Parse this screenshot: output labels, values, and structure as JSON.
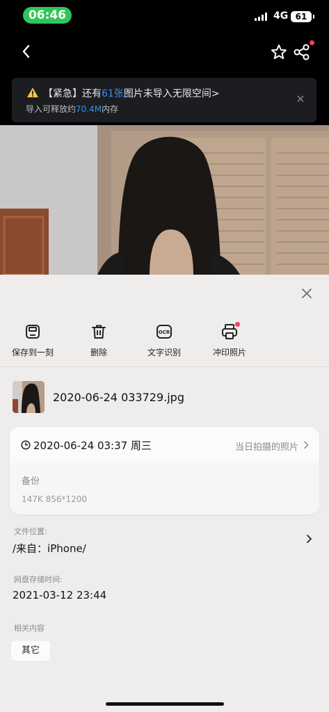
{
  "status_bar": {
    "time": "06:46",
    "network": "4G",
    "battery": "61"
  },
  "banner": {
    "title_prefix": "【紧急】还有",
    "title_count": "61张",
    "title_suffix": "图片未导入无限空间>",
    "sub_prefix": "导入可释放约",
    "sub_size": "70.4M",
    "sub_suffix": "内存"
  },
  "actions": [
    {
      "label": "保存到一刻",
      "icon": "save-icon"
    },
    {
      "label": "删除",
      "icon": "trash-icon"
    },
    {
      "label": "文字识别",
      "icon": "ocr-icon"
    },
    {
      "label": "冲印照片",
      "icon": "print-icon"
    }
  ],
  "file": {
    "name": "2020-06-24 033729.jpg"
  },
  "info_card": {
    "datetime": "2020-06-24 03:37 周三",
    "link_label": "当日拍摄的照片",
    "note_label": "备份",
    "meta": "147K 856*1200"
  },
  "location": {
    "label": "文件位置:",
    "value": "/来自：iPhone/"
  },
  "storage_time": {
    "label": "网盘存储时间:",
    "value": "2021-03-12 23:44"
  },
  "related": {
    "label": "相关内容",
    "tag": "其它"
  },
  "colors": {
    "accent": "#3a8df0",
    "time_pill": "#2fc659",
    "badge": "#ff3b5c"
  }
}
